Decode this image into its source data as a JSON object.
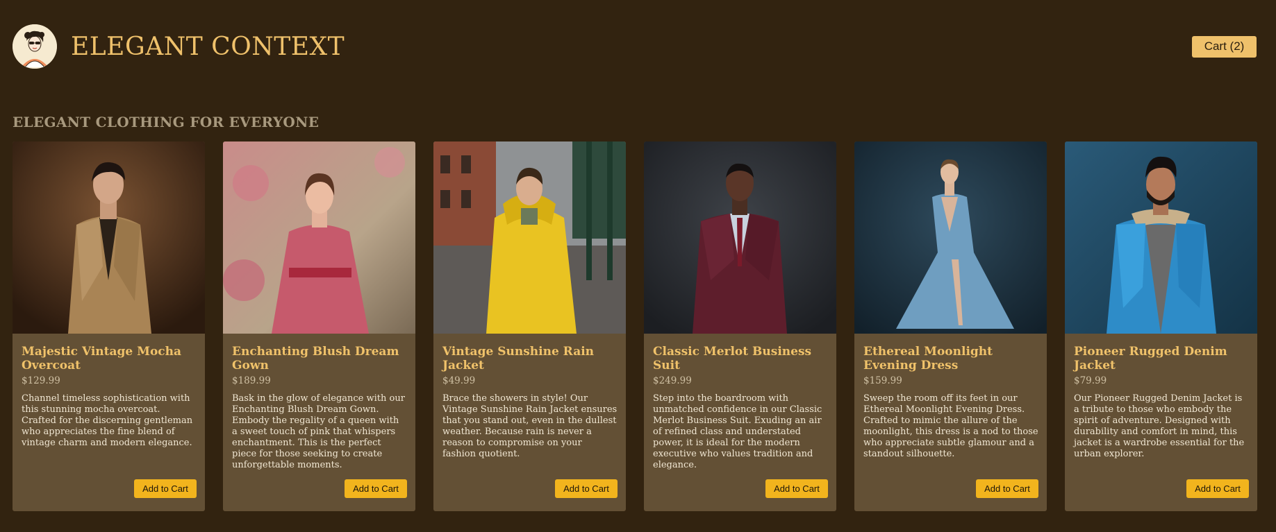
{
  "brand": {
    "name": "ELEGANT CONTEXT",
    "logo_icon": "woman-portrait-logo"
  },
  "cart": {
    "label": "Cart (2)"
  },
  "section_title": "ELEGANT CLOTHING FOR EVERYONE",
  "products": [
    {
      "name": "Majestic Vintage Mocha Overcoat",
      "price": "$129.99",
      "description": "Channel timeless sophistication with this stunning mocha overcoat. Crafted for the discerning gentleman who appreciates the fine blend of vintage charm and modern elegance.",
      "button": "Add to Cart",
      "image_icon": "man-in-mocha-overcoat-photo"
    },
    {
      "name": "Enchanting Blush Dream Gown",
      "price": "$189.99",
      "description": "Bask in the glow of elegance with our Enchanting Blush Dream Gown. Embody the regality of a queen with a sweet touch of pink that whispers enchantment. This is the perfect piece for those seeking to create unforgettable moments.",
      "button": "Add to Cart",
      "image_icon": "woman-in-pink-gown-photo"
    },
    {
      "name": "Vintage Sunshine Rain Jacket",
      "price": "$49.99",
      "description": "Brace the showers in style! Our Vintage Sunshine Rain Jacket ensures that you stand out, even in the dullest weather. Because rain is never a reason to compromise on your fashion quotient.",
      "button": "Add to Cart",
      "image_icon": "man-in-yellow-raincoat-photo"
    },
    {
      "name": "Classic Merlot Business Suit",
      "price": "$249.99",
      "description": "Step into the boardroom with unmatched confidence in our Classic Merlot Business Suit. Exuding an air of refined class and understated power, it is ideal for the modern executive who values tradition and elegance.",
      "button": "Add to Cart",
      "image_icon": "man-in-merlot-suit-photo"
    },
    {
      "name": "Ethereal Moonlight Evening Dress",
      "price": "$159.99",
      "description": "Sweep the room off its feet in our Ethereal Moonlight Evening Dress. Crafted to mimic the allure of the moonlight, this dress is a nod to those who appreciate subtle glamour and a standout silhouette.",
      "button": "Add to Cart",
      "image_icon": "woman-in-blue-evening-dress-photo"
    },
    {
      "name": "Pioneer Rugged Denim Jacket",
      "price": "$79.99",
      "description": "Our Pioneer Rugged Denim Jacket is a tribute to those who embody the spirit of adventure. Designed with durability and comfort in mind, this jacket is a wardrobe essential for the urban explorer.",
      "button": "Add to Cart",
      "image_icon": "man-in-denim-jacket-photo"
    }
  ]
}
